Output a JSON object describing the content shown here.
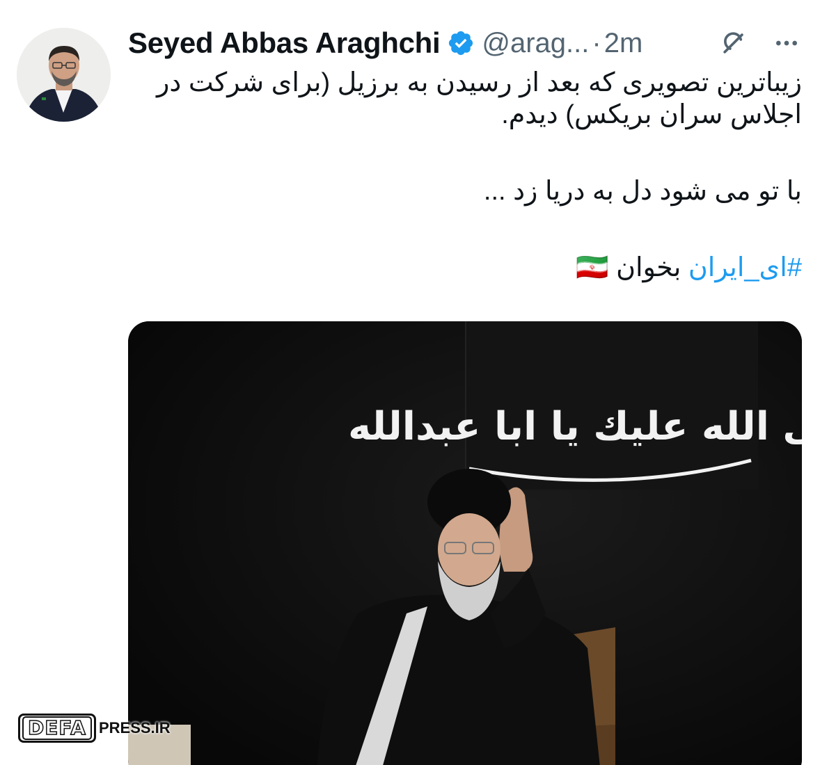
{
  "tweet": {
    "author": {
      "display_name": "Seyed Abbas Araghchi",
      "handle": "@arag...",
      "verified": true
    },
    "separator": "·",
    "time": "2m",
    "text": {
      "paragraph1": "زیباترین تصویری که بعد از رسیدن به برزیل (برای شرکت در اجلاس سران بریکس) دیدم.",
      "paragraph2": "با تو می شود دل به دریا زد ...",
      "hashtag": "#ای_ایران",
      "after_hashtag": " بخوان ",
      "emoji": "🇮🇷"
    },
    "media": {
      "banner_text": "صلى الله عليك يا ابا عبدالله"
    }
  },
  "icons": {
    "verified": "verified-badge-icon",
    "grok": "grok-icon",
    "more": "more-options-icon"
  },
  "colors": {
    "verified": "#1d9bf0",
    "hashtag": "#1d9bf0",
    "secondary_text": "#536471"
  },
  "watermark": {
    "box_text": "DEFA",
    "suffix": "PRESS.IR"
  }
}
